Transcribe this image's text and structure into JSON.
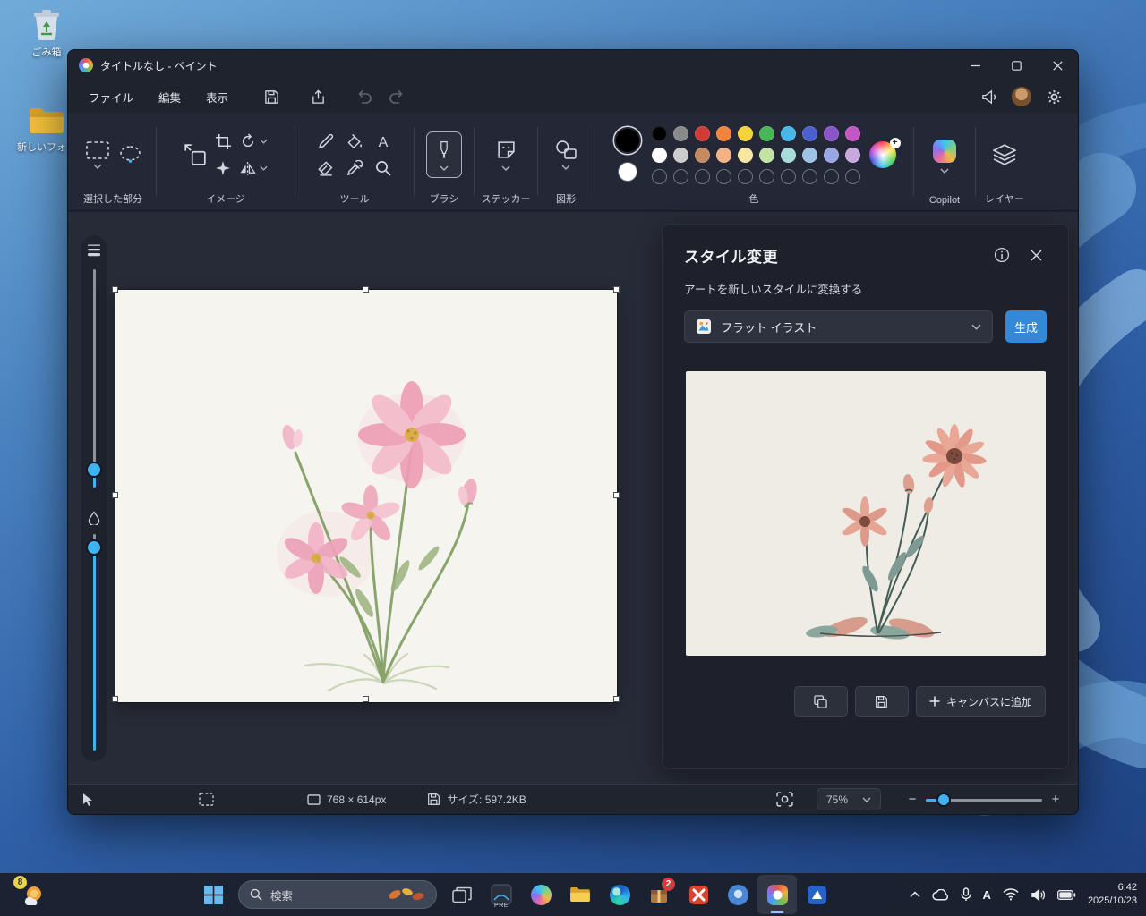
{
  "colors": {
    "accent": "#3fb3f0",
    "generate_button": "#3389d8",
    "window_bg": "#1f232e",
    "ribbon_bg": "#242836",
    "panel_bg": "#1e212b",
    "canvas_bg": "#f6f4ef"
  },
  "desktop": {
    "icons": [
      {
        "label": "ごみ箱"
      },
      {
        "label": "新しいフォル"
      }
    ]
  },
  "paint": {
    "titlebar": {
      "title": "タイトルなし - ペイント"
    },
    "menubar": {
      "items": [
        {
          "label": "ファイル"
        },
        {
          "label": "編集"
        },
        {
          "label": "表示"
        }
      ]
    },
    "ribbon": {
      "groups": {
        "selection": "選択した部分",
        "image": "イメージ",
        "tools": "ツール",
        "brushes": "ブラシ",
        "stickers": "ステッカー",
        "shapes": "図形",
        "colors": "色",
        "copilot": "Copilot",
        "layers": "レイヤー"
      },
      "palette": {
        "foreground": "#000000",
        "background": "#ffffff",
        "row1": [
          "#000000",
          "#8a8a8a",
          "#d23a36",
          "#f2833c",
          "#f5d33a",
          "#46b656",
          "#45b8e8",
          "#4a5fd0",
          "#8a55cc",
          "#c455c4"
        ],
        "row2": [
          "#ffffff",
          "#cccccc",
          "#c68a5e",
          "#f4b183",
          "#f8e7a1",
          "#c3e3a2",
          "#a8dcd8",
          "#9dc3e6",
          "#98a6e4",
          "#c9a8e0"
        ]
      }
    },
    "style_panel": {
      "title": "スタイル変更",
      "subtitle": "アートを新しいスタイルに変換する",
      "style_value": "フラット イラスト",
      "generate_label": "生成",
      "add_to_canvas_label": "キャンバスに追加"
    },
    "statusbar": {
      "dimensions": "768 × 614px",
      "file_size": "サイズ: 597.2KB",
      "zoom": "75%"
    }
  },
  "taskbar": {
    "widgets_badge": "8",
    "search_label": "検索",
    "apps": {
      "package_badge": "2",
      "pre_label": "PRE"
    },
    "tray": {
      "ime": "A",
      "time": "6:42",
      "date": "2025/10/23"
    }
  }
}
